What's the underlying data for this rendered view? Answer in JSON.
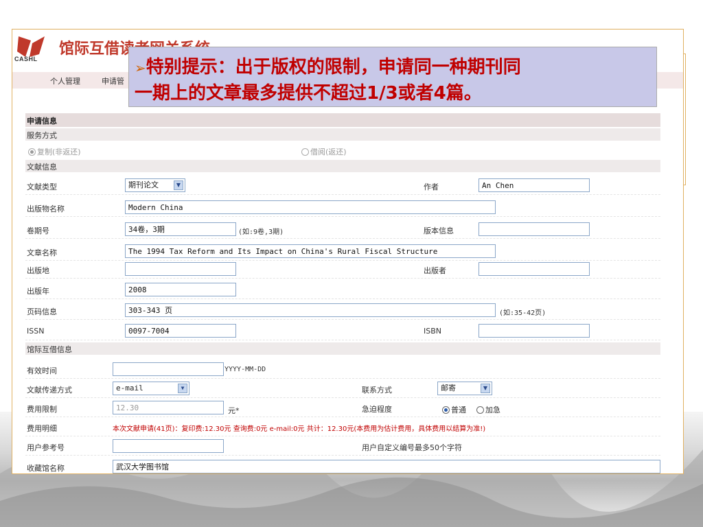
{
  "brand": {
    "logo_text": "CASHL",
    "title": "馆际互借读者网关系统"
  },
  "nav": [
    "个人管理",
    "申请管"
  ],
  "callout": {
    "bullet": "➢",
    "line1": "特别提示：出于版权的限制，申请同一种期刊同",
    "line2": "一期上的文章最多提供不超过1/3或者4篇。"
  },
  "form": {
    "section_apply": "申请信息",
    "service_label": "服务方式",
    "service_copy": "复制(非返还)",
    "service_loan": "借阅(返还)",
    "doc_info": "文献信息",
    "doc_type_label": "文献类型",
    "doc_type_value": "期刊论文",
    "author_label": "作者",
    "author_value": "An Chen",
    "pub_name_label": "出版物名称",
    "pub_name_value": "Modern China",
    "volume_label": "卷期号",
    "volume_value": "34卷，3期",
    "volume_hint": "(如:9卷,3期)",
    "edition_label": "版本信息",
    "edition_value": "",
    "article_label": "文章名称",
    "article_value": "The 1994 Tax Reform and Its Impact on China's Rural Fiscal Structure",
    "place_label": "出版地",
    "place_value": "",
    "publisher_label": "出版者",
    "publisher_value": "",
    "year_label": "出版年",
    "year_value": "2008",
    "pages_label": "页码信息",
    "pages_value": "303-343 页",
    "pages_hint": "(如:35-42页)",
    "issn_label": "ISSN",
    "issn_value": "0097-7004",
    "isbn_label": "ISBN",
    "isbn_value": "",
    "ill_info": "馆际互借信息",
    "valid_label": "有效时间",
    "valid_value": "",
    "valid_hint": "YYYY-MM-DD",
    "delivery_label": "文献传递方式",
    "delivery_value": "e-mail",
    "contact_label": "联系方式",
    "contact_value": "邮寄",
    "fee_limit_label": "费用限制",
    "fee_limit_value": "12.30",
    "fee_limit_unit": "元*",
    "urgency_label": "急迫程度",
    "urgency_normal": "普通",
    "urgency_rush": "加急",
    "fee_detail_label": "费用明细",
    "fee_detail_value": "本次文献申请(41页)：复印费:12.30元  查询费:0元  e-mail:0元   共计：12.30元(本费用为估计费用，具体费用以结算为准!)",
    "user_ref_label": "用户参考号",
    "user_ref_value": "",
    "user_ref_hint": "用户自定义编号最多50个字符",
    "library_label": "收藏馆名称",
    "library_value": "武汉大学图书馆"
  },
  "colors": {
    "accent": "#c00000",
    "callout_bg": "#c8c8e8",
    "border": "#e0b060"
  }
}
